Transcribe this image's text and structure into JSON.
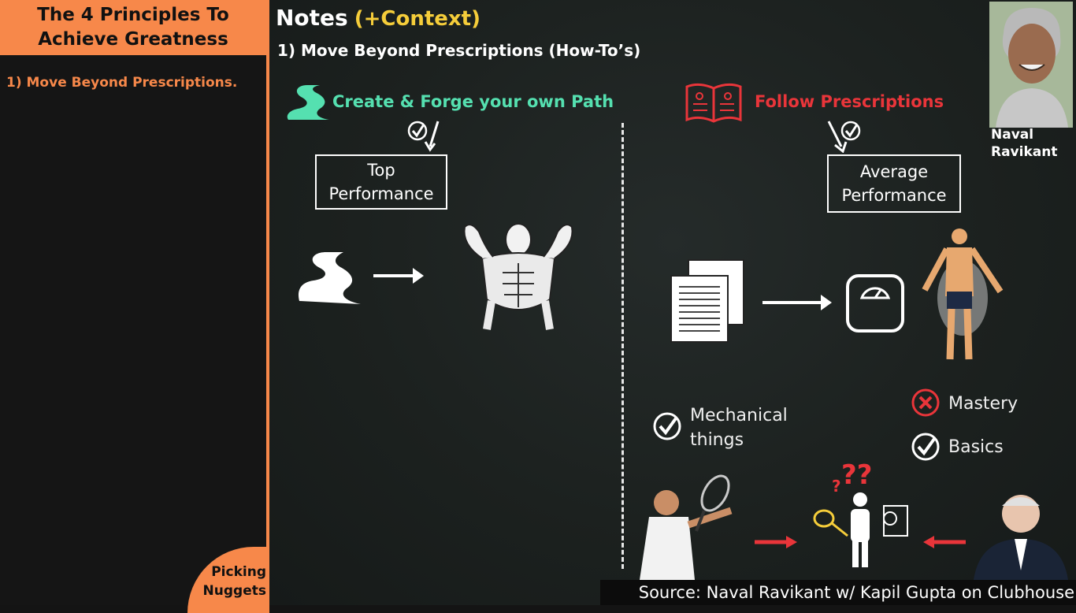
{
  "sidebar": {
    "title": "The 4 Principles To Achieve Greatness",
    "items": [
      "1) Move Beyond Prescriptions."
    ],
    "brand": "Picking Nuggets"
  },
  "header": {
    "title": "Notes",
    "subtitle": "(+Context)",
    "section": "1) Move Beyond Prescriptions (How-To’s)"
  },
  "left": {
    "heading": "Create & Forge your own Path",
    "outcome": "Top Performance"
  },
  "right": {
    "heading": "Follow Prescriptions",
    "outcome": "Average Performance"
  },
  "speaker": {
    "name": "Naval Ravikant"
  },
  "lists": {
    "mechanical": "Mechanical things",
    "mastery": "Mastery",
    "basics": "Basics"
  },
  "source": "Source: Naval Ravikant w/ Kapil Gupta on Clubhouse",
  "colors": {
    "accent_orange": "#f7884a",
    "teal": "#55e0b0",
    "red": "#e9353a",
    "yellow": "#f5cd3a"
  },
  "icons": [
    "path-icon",
    "book-icon",
    "check-icon",
    "cross-icon",
    "scale-icon",
    "documents-icon",
    "arrow-icon",
    "person-icon",
    "question-icon"
  ]
}
